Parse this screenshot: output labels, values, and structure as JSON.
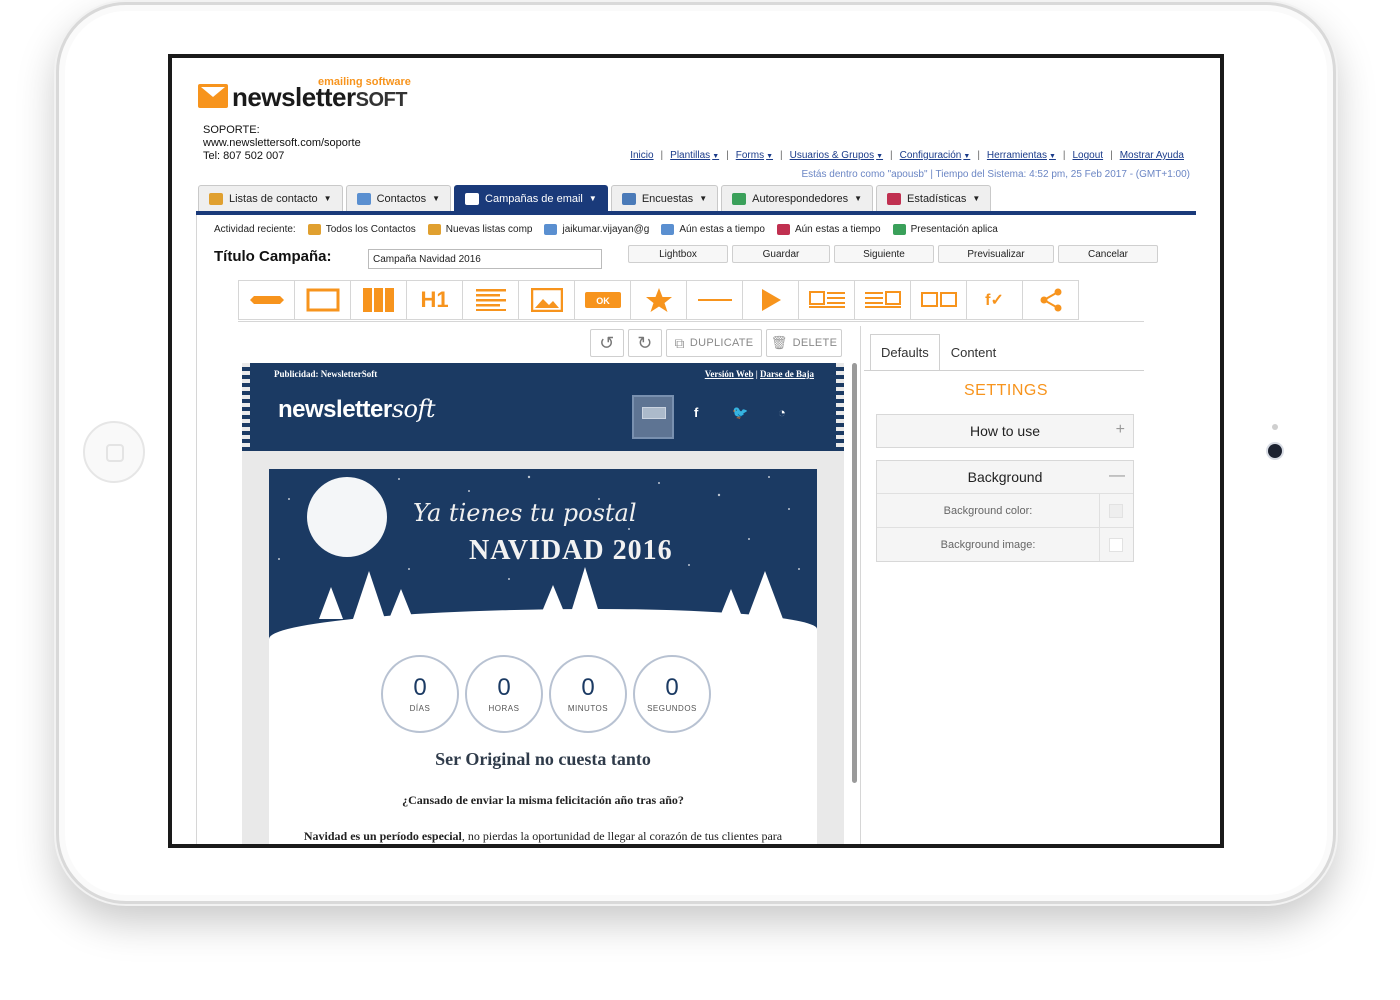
{
  "header": {
    "logo_tagline": "emailing software",
    "logo_main": "newsletter",
    "logo_soft": "SOFT",
    "support_lines": [
      "SOPORTE:",
      "www.newslettersoft.com/soporte",
      "Tel: 807 502 007"
    ]
  },
  "topnav": {
    "items": [
      "Inicio",
      "Plantillas",
      "Forms",
      "Usuarios & Grupos",
      "Configuración",
      "Herramientas",
      "Logout",
      "Mostrar Ayuda"
    ],
    "session": "Estás dentro como \"apousb\" | Tiempo del Sistema: 4:52 pm, 25 Feb 2017 - (GMT+1:00)"
  },
  "tabs": [
    {
      "label": "Listas de contacto",
      "icon_color": "#e0a030"
    },
    {
      "label": "Contactos",
      "icon_color": "#5a8fd0"
    },
    {
      "label": "Campañas de email",
      "icon_color": "#ffffff"
    },
    {
      "label": "Encuestas",
      "icon_color": "#4a7ab8"
    },
    {
      "label": "Autorespondedores",
      "icon_color": "#3aa05a"
    },
    {
      "label": "Estadísticas",
      "icon_color": "#c03050"
    }
  ],
  "activity": {
    "label": "Actividad reciente:",
    "items": [
      {
        "label": "Todos los Contactos",
        "icon_color": "#e0a030"
      },
      {
        "label": "Nuevas listas comp",
        "icon_color": "#e0a030"
      },
      {
        "label": "jaikumar.vijayan@g",
        "icon_color": "#5a8fd0"
      },
      {
        "label": "Aún estas a tiempo",
        "icon_color": "#5a8fd0"
      },
      {
        "label": "Aún estas a tiempo",
        "icon_color": "#c03050"
      },
      {
        "label": "Presentación aplica",
        "icon_color": "#3aa05a"
      }
    ]
  },
  "campaign": {
    "title_label": "Título Campaña:",
    "title_value": "Campaña Navidad 2016",
    "buttons": [
      "Lightbox",
      "Guardar",
      "Siguiente",
      "Previsualizar",
      "Cancelar"
    ]
  },
  "block_icons": [
    "divider-block-icon",
    "box-block-icon",
    "columns-block-icon",
    "h1-block-icon",
    "text-block-icon",
    "image-block-icon",
    "button-block-icon",
    "star-block-icon",
    "line-block-icon",
    "video-block-icon",
    "image-text-block-icon",
    "text-image-block-icon",
    "image-image-block-icon",
    "social-block-icon",
    "share-block-icon"
  ],
  "editor_buttons": {
    "duplicate": "DUPLICATE",
    "delete": "DELETE"
  },
  "email": {
    "publicity": "Publicidad: NewsletterSoft",
    "web_version": "Versión Web",
    "unsubscribe": "Darse de Baja",
    "logo_main": "newsletter",
    "logo_soft": "soft",
    "banner_script": "Ya tienes tu postal",
    "banner_title": "NAVIDAD 2016",
    "counters": [
      {
        "value": "0",
        "label": "DÍAS"
      },
      {
        "value": "0",
        "label": "HORAS"
      },
      {
        "value": "0",
        "label": "MINUTOS"
      },
      {
        "value": "0",
        "label": "SEGUNDOS"
      }
    ],
    "heading": "Ser Original no cuesta tanto",
    "subheading": "¿Cansado de enviar la misma felicitación año tras año?",
    "paragraph_bold": "Navidad es un período especial",
    "paragraph_rest": ", no pierdas la oportunidad de llegar al corazón de tus clientes para"
  },
  "right_panel": {
    "tabs": [
      "Defaults",
      "Content"
    ],
    "settings_title": "SETTINGS",
    "how_to_use": "How to use",
    "background": "Background",
    "bg_color_label": "Background color:",
    "bg_image_label": "Background image:"
  },
  "colors": {
    "accent": "#f7941d",
    "brand": "#1a3a7a",
    "email_bg": "#1b3a63"
  }
}
